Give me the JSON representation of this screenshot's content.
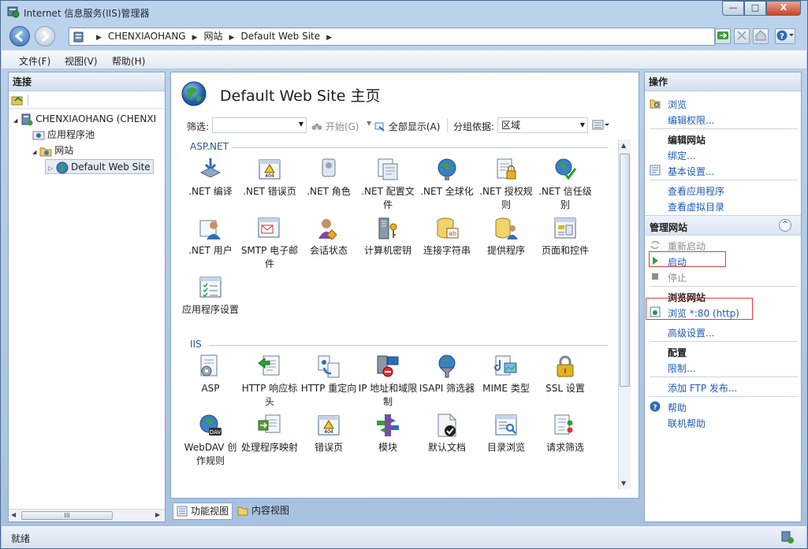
{
  "window": {
    "title": "Internet 信息服务(IIS)管理器",
    "controls": {
      "minimize": "—",
      "maximize": "□",
      "close": "X"
    }
  },
  "address": {
    "crumbs": [
      "CHENXIAOHANG",
      "网站",
      "Default Web Site"
    ]
  },
  "menu": {
    "items": [
      "文件(F)",
      "视图(V)",
      "帮助(H)"
    ]
  },
  "connections": {
    "header": "连接",
    "tree": [
      {
        "label": "CHENXIAOHANG (CHENXI",
        "icon": "server-icon",
        "expander": "◢"
      },
      {
        "label": "应用程序池",
        "icon": "app-pool-icon",
        "expander": ""
      },
      {
        "label": "网站",
        "icon": "sites-folder-icon",
        "expander": "◢"
      },
      {
        "label": "Default Web Site",
        "icon": "website-globe-icon",
        "expander": "▷"
      }
    ],
    "scroll_thumb": "III"
  },
  "center": {
    "title": "Default Web Site 主页",
    "filter_label": "筛选:",
    "start_label": "开始(G)",
    "show_all_label": "全部显示(A)",
    "group_label": "分组依据:",
    "group_value": "区域",
    "sections": [
      {
        "title": "ASP.NET",
        "features": [
          {
            "label": ".NET 编译",
            "icon": "net-compile-icon"
          },
          {
            "label": ".NET 错误页",
            "icon": "net-error-page-icon"
          },
          {
            "label": ".NET 角色",
            "icon": "net-roles-icon"
          },
          {
            "label": ".NET 配置文件",
            "icon": "net-profile-icon"
          },
          {
            "label": ".NET 全球化",
            "icon": "net-globalization-icon"
          },
          {
            "label": ".NET 授权规则",
            "icon": "net-authorization-icon"
          },
          {
            "label": ".NET 信任级别",
            "icon": "net-trust-level-icon"
          },
          {
            "label": ".NET 用户",
            "icon": "net-users-icon"
          },
          {
            "label": "SMTP 电子邮件",
            "icon": "smtp-email-icon"
          },
          {
            "label": "会话状态",
            "icon": "session-state-icon"
          },
          {
            "label": "计算机密钥",
            "icon": "machine-key-icon"
          },
          {
            "label": "连接字符串",
            "icon": "connection-strings-icon"
          },
          {
            "label": "提供程序",
            "icon": "providers-icon"
          },
          {
            "label": "页面和控件",
            "icon": "pages-controls-icon"
          },
          {
            "label": "应用程序设置",
            "icon": "app-settings-icon"
          }
        ]
      },
      {
        "title": "IIS",
        "features": [
          {
            "label": "ASP",
            "icon": "asp-icon"
          },
          {
            "label": "HTTP 响应标头",
            "icon": "http-response-headers-icon"
          },
          {
            "label": "HTTP 重定向",
            "icon": "http-redirect-icon"
          },
          {
            "label": "IP 地址和域限制",
            "icon": "ip-domain-restrictions-icon"
          },
          {
            "label": "ISAPI 筛选器",
            "icon": "isapi-filters-icon"
          },
          {
            "label": "MIME 类型",
            "icon": "mime-types-icon"
          },
          {
            "label": "SSL 设置",
            "icon": "ssl-settings-icon"
          },
          {
            "label": "WebDAV 创作规则",
            "icon": "webdav-icon"
          },
          {
            "label": "处理程序映射",
            "icon": "handler-mappings-icon"
          },
          {
            "label": "错误页",
            "icon": "error-pages-icon"
          },
          {
            "label": "模块",
            "icon": "modules-icon"
          },
          {
            "label": "默认文档",
            "icon": "default-document-icon"
          },
          {
            "label": "目录浏览",
            "icon": "directory-browsing-icon"
          },
          {
            "label": "请求筛选",
            "icon": "request-filtering-icon"
          }
        ]
      }
    ],
    "view_tabs": [
      "功能视图",
      "内容视图"
    ]
  },
  "actions": {
    "header": "操作",
    "browse": "浏览",
    "edit_permissions": "编辑权限...",
    "edit_site_head": "编辑网站",
    "bindings": "绑定...",
    "basic_settings": "基本设置...",
    "view_applications": "查看应用程序",
    "view_virtual_dirs": "查看虚拟目录",
    "manage_site_head": "管理网站",
    "restart": "重新启动",
    "start": "启动",
    "stop": "停止",
    "browse_site_head": "浏览网站",
    "browse_port": "浏览 *:80 (http)",
    "advanced_settings": "高级设置...",
    "config_head": "配置",
    "limits": "限制...",
    "add_ftp": "添加 FTP 发布...",
    "help": "帮助",
    "online_help": "联机帮助",
    "collapse": "^"
  },
  "status": {
    "text": "就绪"
  },
  "colors": {
    "link": "#1f5bb5",
    "highlight": "#e43b3b",
    "section": "#2a5a93"
  }
}
